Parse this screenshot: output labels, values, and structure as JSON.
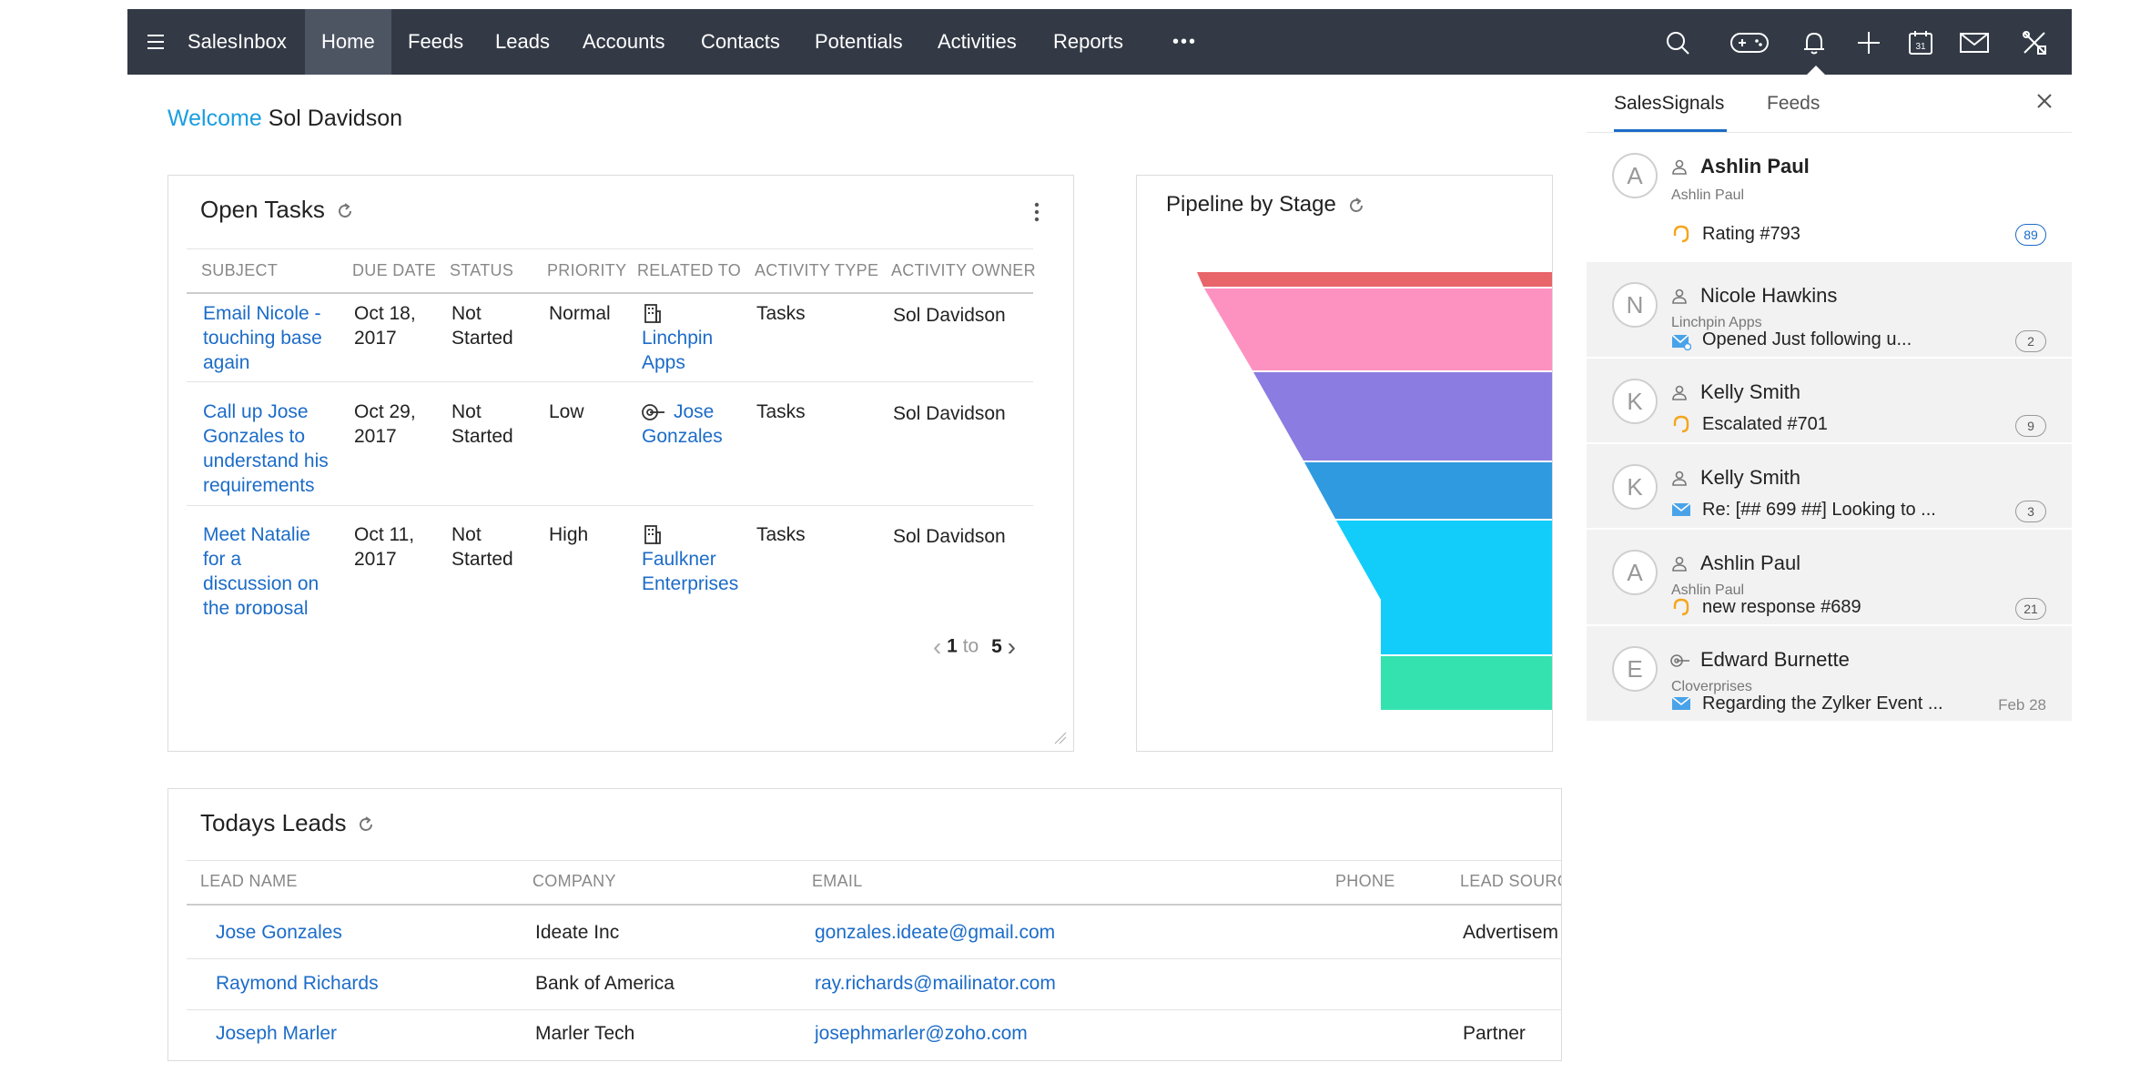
{
  "topbar": {
    "brand": "SalesInbox",
    "nav": [
      "Home",
      "Feeds",
      "Leads",
      "Accounts",
      "Contacts",
      "Potentials",
      "Activities",
      "Reports"
    ],
    "active": "Home",
    "more": "•••",
    "icons": [
      "search-icon",
      "gamepad-icon",
      "bell-icon",
      "plus-icon",
      "calendar-icon",
      "mail-icon",
      "tools-icon"
    ],
    "calendar_day": "31"
  },
  "welcome": {
    "greeting": "Welcome",
    "user": "Sol Davidson"
  },
  "open_tasks": {
    "title": "Open Tasks",
    "columns": [
      "SUBJECT",
      "DUE DATE",
      "STATUS",
      "PRIORITY",
      "RELATED TO",
      "ACTIVITY TYPE",
      "ACTIVITY OWNER"
    ],
    "rows": [
      {
        "subject": [
          "Email Nicole -",
          "touching base",
          "again"
        ],
        "due": [
          "Oct 18,",
          "2017"
        ],
        "status": [
          "Not",
          "Started"
        ],
        "priority": "Normal",
        "related_icon": "building-icon",
        "related": [
          "Linchpin",
          "Apps"
        ],
        "type": "Tasks",
        "owner": "Sol Davidson"
      },
      {
        "subject": [
          "Call up Jose",
          "Gonzales to",
          "understand his",
          "requirements"
        ],
        "due": [
          "Oct 29,",
          "2017"
        ],
        "status": [
          "Not",
          "Started"
        ],
        "priority": "Low",
        "related_icon": "target-icon",
        "related": [
          "Jose",
          "Gonzales"
        ],
        "type": "Tasks",
        "owner": "Sol Davidson"
      },
      {
        "subject": [
          "Meet Natalie",
          "for a",
          "discussion on",
          "the proposal"
        ],
        "due": [
          "Oct 11,",
          "2017"
        ],
        "status": [
          "Not",
          "Started"
        ],
        "priority": "High",
        "related_icon": "building-icon",
        "related": [
          "Faulkner",
          "Enterprises"
        ],
        "type": "Tasks",
        "owner": "Sol Davidson"
      }
    ],
    "pager": {
      "from": "1",
      "to_word": "to",
      "to": "5"
    }
  },
  "pipeline": {
    "title": "Pipeline by Stage",
    "colors": [
      "#e8656a",
      "#fd92c1",
      "#8a7ce0",
      "#2f9ae0",
      "#12cdfa",
      "#34e2b0"
    ]
  },
  "todays_leads": {
    "title": "Todays Leads",
    "columns": [
      "LEAD NAME",
      "COMPANY",
      "EMAIL",
      "PHONE",
      "LEAD SOURC"
    ],
    "rows": [
      {
        "name": "Jose Gonzales",
        "company": "Ideate Inc",
        "email": "gonzales.ideate@gmail.com",
        "phone": "",
        "source": "Advertisem"
      },
      {
        "name": "Raymond Richards",
        "company": "Bank of America",
        "email": "ray.richards@mailinator.com",
        "phone": "",
        "source": ""
      },
      {
        "name": "Joseph Marler",
        "company": "Marler Tech",
        "email": "josephmarler@zoho.com",
        "phone": "",
        "source": "Partner"
      }
    ]
  },
  "signals_panel": {
    "tabs": [
      "SalesSignals",
      "Feeds"
    ],
    "active_tab": "SalesSignals",
    "items": [
      {
        "initial": "A",
        "name": "Ashlin Paul",
        "person_icon": "person-icon",
        "sub": "Ashlin Paul",
        "activity_icon": "support-icon",
        "text": "Rating #793",
        "badge": "89",
        "badge_style": "blue",
        "shaded": false
      },
      {
        "initial": "N",
        "name": "Nicole Hawkins",
        "person_icon": "person-icon",
        "sub": "Linchpin Apps",
        "activity_icon": "mail-open-icon",
        "text": "Opened  Just following u...",
        "badge": "2",
        "badge_style": "grey",
        "shaded": true
      },
      {
        "initial": "K",
        "name": "Kelly Smith",
        "person_icon": "person-icon",
        "sub": "",
        "activity_icon": "support-icon",
        "text": "Escalated #701",
        "badge": "9",
        "badge_style": "grey",
        "shaded": true
      },
      {
        "initial": "K",
        "name": "Kelly Smith",
        "person_icon": "person-icon",
        "sub": "",
        "activity_icon": "mail-icon",
        "text": "Re: [## 699 ##] Looking to ...",
        "badge": "3",
        "badge_style": "grey",
        "shaded": true
      },
      {
        "initial": "A",
        "name": "Ashlin Paul",
        "person_icon": "person-icon",
        "sub": "Ashlin Paul",
        "activity_icon": "support-icon",
        "text": "new response #689",
        "badge": "21",
        "badge_style": "grey",
        "shaded": true
      },
      {
        "initial": "E",
        "name": "Edward Burnette",
        "person_icon": "target-icon",
        "sub": "Cloverprises",
        "activity_icon": "mail-icon",
        "text": "Regarding the Zylker Event ...",
        "date": "Feb 28",
        "shaded": true
      }
    ]
  }
}
